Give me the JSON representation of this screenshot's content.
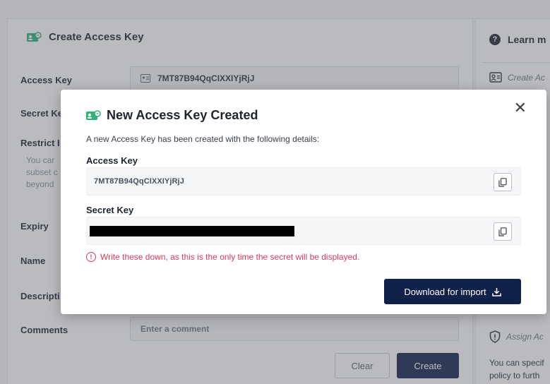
{
  "form": {
    "title": "Create Access Key",
    "access_key_label": "Access Key",
    "access_key_value": "7MT87B94QqCIXXIYjRjJ",
    "secret_key_label": "Secret Ke",
    "restrict_label": "Restrict I",
    "restrict_help": [
      "You car",
      "subset c",
      "beyond"
    ],
    "expiry_label": "Expiry",
    "name_label": "Name",
    "description_label": "Descripti",
    "comments_label": "Comments",
    "comments_placeholder": "Enter a comment",
    "clear_label": "Clear",
    "create_label": "Create"
  },
  "sidebar": {
    "heading": "Learn m",
    "item1": "Create Ac",
    "item2": "Assign Ac",
    "text_lines": [
      "You can specif",
      "policy to furth"
    ]
  },
  "modal": {
    "title": "New Access Key Created",
    "description": "A new Access Key has been created with the following details:",
    "access_key_label": "Access Key",
    "access_key_value": "7MT87B94QqCIXXIYjRjJ",
    "secret_key_label": "Secret Key",
    "warning": "Write these down, as this is the only time the secret will be displayed.",
    "download_label": "Download for import"
  },
  "colors": {
    "accent_green": "#2fb37a",
    "primary_navy": "#11224a",
    "warning_red": "#d93a5c"
  },
  "icons": [
    "access-key-icon",
    "close-icon",
    "copy-icon",
    "warning-icon",
    "download-icon",
    "help-icon",
    "shield-icon"
  ]
}
